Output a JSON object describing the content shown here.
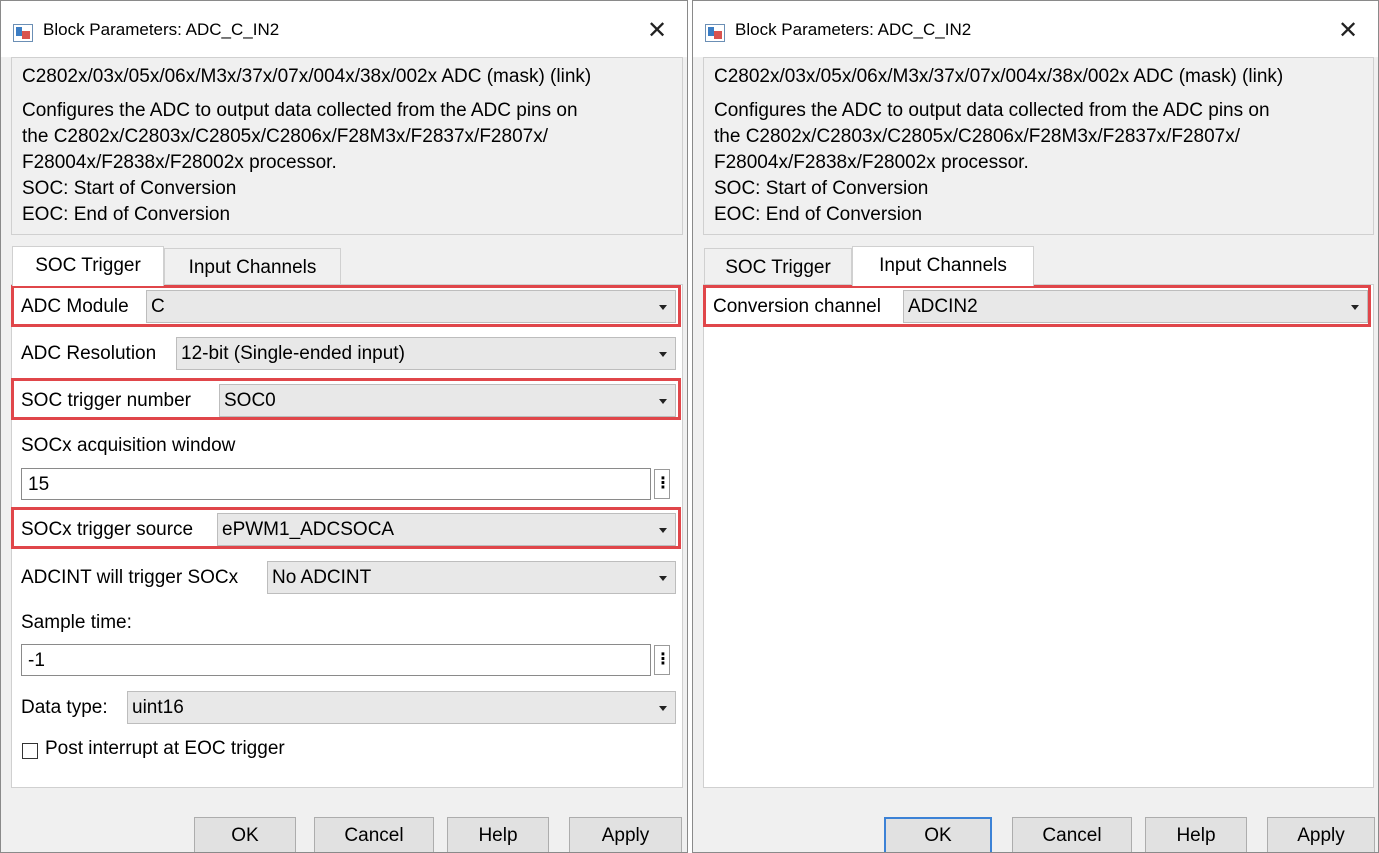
{
  "left_dialog": {
    "title": "Block Parameters: ADC_C_IN2",
    "mask_title": "C2802x/03x/05x/06x/M3x/37x/07x/004x/38x/002x ADC (mask) (link)",
    "description": "Configures the ADC to output data collected from the ADC pins on\nthe C2802x/C2803x/C2805x/C2806x/F28M3x/F2837x/F2807x/\nF28004x/F2838x/F28002x processor.\nSOC: Start of Conversion\nEOC: End of Conversion",
    "tabs": [
      {
        "label": "SOC Trigger",
        "active": true
      },
      {
        "label": "Input Channels",
        "active": false
      }
    ],
    "fields": {
      "adc_module": {
        "label": "ADC Module",
        "value": "C",
        "highlighted": true
      },
      "adc_resolution": {
        "label": "ADC Resolution",
        "value": "12-bit (Single-ended input)"
      },
      "soc_trigger_number": {
        "label": "SOC trigger number",
        "value": "SOC0",
        "highlighted": true
      },
      "acquisition_window": {
        "label": "SOCx acquisition window",
        "value": "15"
      },
      "trigger_source": {
        "label": "SOCx trigger source",
        "value": "ePWM1_ADCSOCA",
        "highlighted": true
      },
      "adcint_trigger": {
        "label": "ADCINT will trigger SOCx",
        "value": "No ADCINT"
      },
      "sample_time": {
        "label": "Sample time:",
        "value": "-1"
      },
      "data_type": {
        "label": "Data type:",
        "value": "uint16"
      },
      "post_interrupt": {
        "label": "Post interrupt at EOC trigger",
        "checked": false
      }
    },
    "buttons": {
      "ok": "OK",
      "cancel": "Cancel",
      "help": "Help",
      "apply": "Apply"
    }
  },
  "right_dialog": {
    "title": "Block Parameters: ADC_C_IN2",
    "mask_title": "C2802x/03x/05x/06x/M3x/37x/07x/004x/38x/002x ADC (mask) (link)",
    "description": "Configures the ADC to output data collected from the ADC pins on\nthe C2802x/C2803x/C2805x/C2806x/F28M3x/F2837x/F2807x/\nF28004x/F2838x/F28002x processor.\nSOC: Start of Conversion\nEOC: End of Conversion",
    "tabs": [
      {
        "label": "SOC Trigger",
        "active": false
      },
      {
        "label": "Input Channels",
        "active": true
      }
    ],
    "fields": {
      "conversion_channel": {
        "label": "Conversion channel",
        "value": "ADCIN2",
        "highlighted": true
      }
    },
    "buttons": {
      "ok": "OK",
      "cancel": "Cancel",
      "help": "Help",
      "apply": "Apply"
    }
  },
  "colors": {
    "highlight": "#e0464a",
    "default_button_border": "#3c82d6",
    "dialog_bg": "#f0f0f0"
  },
  "icons": {
    "app_icon": "simulink-block-icon",
    "close": "close-icon",
    "dropdown": "chevron-down-icon",
    "menu": "vertical-ellipsis-icon"
  }
}
